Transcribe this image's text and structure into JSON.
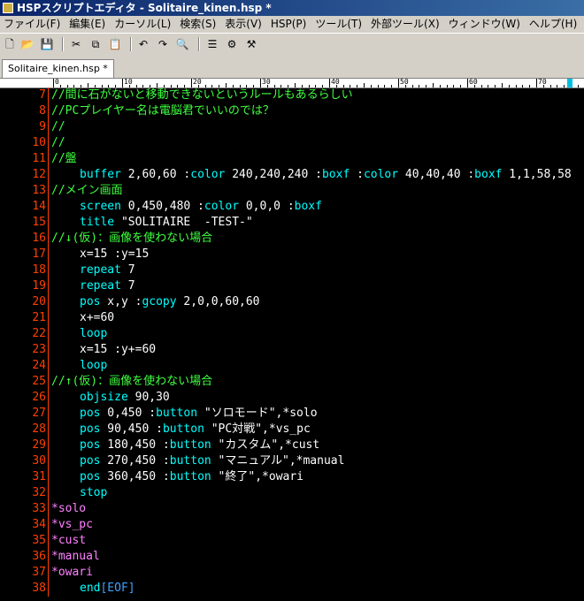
{
  "window": {
    "title": "HSPスクリプトエディタ - Solitaire_kinen.hsp *"
  },
  "menu": [
    "ファイル(F)",
    "編集(E)",
    "カーソル(L)",
    "検索(S)",
    "表示(V)",
    "HSP(P)",
    "ツール(T)",
    "外部ツール(X)",
    "ウィンドウ(W)",
    "ヘルプ(H)"
  ],
  "toolbar": {
    "buttons": [
      {
        "name": "new-file-icon",
        "glyph": "🗋"
      },
      {
        "name": "open-folder-icon",
        "glyph": "📂"
      },
      {
        "name": "save-icon",
        "glyph": "💾"
      },
      {
        "name": "cut-icon",
        "glyph": "✂"
      },
      {
        "name": "copy-icon",
        "glyph": "⧉"
      },
      {
        "name": "paste-icon",
        "glyph": "📋"
      },
      {
        "name": "undo-icon",
        "glyph": "↶"
      },
      {
        "name": "redo-icon",
        "glyph": "↷"
      },
      {
        "name": "find-replace-icon",
        "glyph": "🔍"
      },
      {
        "name": "list-icon",
        "glyph": "☰"
      },
      {
        "name": "run-icon",
        "glyph": "⚙"
      },
      {
        "name": "tools-icon",
        "glyph": "⚒"
      }
    ]
  },
  "tabs": [
    {
      "label": "Solitaire_kinen.hsp *"
    }
  ],
  "ruler": {
    "labels": [
      "0",
      "10",
      "20",
      "30",
      "40",
      "50",
      "60",
      "70"
    ]
  },
  "editor": {
    "lines": [
      {
        "n": "7",
        "indent": false,
        "tokens": [
          [
            "c",
            "//間に石がないと移動できないというルールもあるらしい"
          ]
        ]
      },
      {
        "n": "8",
        "indent": false,
        "tokens": [
          [
            "c",
            "//PCプレイヤー名は電脳君でいいのでは？"
          ]
        ]
      },
      {
        "n": "9",
        "indent": false,
        "tokens": [
          [
            "c",
            "//"
          ]
        ]
      },
      {
        "n": "10",
        "indent": false,
        "tokens": [
          [
            "c",
            "//"
          ]
        ]
      },
      {
        "n": "11",
        "indent": false,
        "tokens": [
          [
            "c",
            "//盤"
          ]
        ]
      },
      {
        "n": "12",
        "indent": true,
        "tokens": [
          [
            "k",
            "buffer"
          ],
          [
            "t",
            " 2,60,60 :"
          ],
          [
            "k",
            "color"
          ],
          [
            "t",
            " 240,240,240 :"
          ],
          [
            "k",
            "boxf"
          ],
          [
            "t",
            " :"
          ],
          [
            "k",
            "color"
          ],
          [
            "t",
            " 40,40,40 :"
          ],
          [
            "k",
            "boxf"
          ],
          [
            "t",
            " 1,1,58,58"
          ]
        ]
      },
      {
        "n": "13",
        "indent": false,
        "tokens": [
          [
            "c",
            "//メイン画面"
          ]
        ]
      },
      {
        "n": "14",
        "indent": true,
        "tokens": [
          [
            "k",
            "screen"
          ],
          [
            "t",
            " 0,450,480 :"
          ],
          [
            "k",
            "color"
          ],
          [
            "t",
            " 0,0,0 :"
          ],
          [
            "k",
            "boxf"
          ]
        ]
      },
      {
        "n": "15",
        "indent": true,
        "tokens": [
          [
            "k",
            "title"
          ],
          [
            "t",
            " \"SOLITAIRE  -TEST-\""
          ]
        ]
      },
      {
        "n": "16",
        "indent": false,
        "tokens": [
          [
            "c",
            "//↓(仮)：画像を使わない場合"
          ]
        ]
      },
      {
        "n": "17",
        "indent": true,
        "tokens": [
          [
            "t",
            "x=15 :y=15"
          ]
        ]
      },
      {
        "n": "18",
        "indent": true,
        "tokens": [
          [
            "k",
            "repeat"
          ],
          [
            "t",
            " 7"
          ]
        ]
      },
      {
        "n": "19",
        "indent": true,
        "tokens": [
          [
            "k",
            "repeat"
          ],
          [
            "t",
            " 7"
          ]
        ]
      },
      {
        "n": "20",
        "indent": true,
        "tokens": [
          [
            "k",
            "pos"
          ],
          [
            "t",
            " x,y :"
          ],
          [
            "k",
            "gcopy"
          ],
          [
            "t",
            " 2,0,0,60,60"
          ]
        ]
      },
      {
        "n": "21",
        "indent": true,
        "tokens": [
          [
            "t",
            "x+=60"
          ]
        ]
      },
      {
        "n": "22",
        "indent": true,
        "tokens": [
          [
            "k",
            "loop"
          ]
        ]
      },
      {
        "n": "23",
        "indent": true,
        "tokens": [
          [
            "t",
            "x=15 :y+=60"
          ]
        ]
      },
      {
        "n": "24",
        "indent": true,
        "tokens": [
          [
            "k",
            "loop"
          ]
        ]
      },
      {
        "n": "25",
        "indent": false,
        "tokens": [
          [
            "c",
            "//↑(仮)：画像を使わない場合"
          ]
        ]
      },
      {
        "n": "26",
        "indent": true,
        "tokens": [
          [
            "k",
            "objsize"
          ],
          [
            "t",
            " 90,30"
          ]
        ]
      },
      {
        "n": "27",
        "indent": true,
        "tokens": [
          [
            "k",
            "pos"
          ],
          [
            "t",
            " 0,450 :"
          ],
          [
            "k",
            "button"
          ],
          [
            "t",
            " \"ソロモード\",*solo"
          ]
        ]
      },
      {
        "n": "28",
        "indent": true,
        "tokens": [
          [
            "k",
            "pos"
          ],
          [
            "t",
            " 90,450 :"
          ],
          [
            "k",
            "button"
          ],
          [
            "t",
            " \"PC対戦\",*vs_pc"
          ]
        ]
      },
      {
        "n": "29",
        "indent": true,
        "tokens": [
          [
            "k",
            "pos"
          ],
          [
            "t",
            " 180,450 :"
          ],
          [
            "k",
            "button"
          ],
          [
            "t",
            " \"カスタム\",*cust"
          ]
        ]
      },
      {
        "n": "30",
        "indent": true,
        "tokens": [
          [
            "k",
            "pos"
          ],
          [
            "t",
            " 270,450 :"
          ],
          [
            "k",
            "button"
          ],
          [
            "t",
            " \"マニュアル\",*manual"
          ]
        ]
      },
      {
        "n": "31",
        "indent": true,
        "tokens": [
          [
            "k",
            "pos"
          ],
          [
            "t",
            " 360,450 :"
          ],
          [
            "k",
            "button"
          ],
          [
            "t",
            " \"終了\",*owari"
          ]
        ]
      },
      {
        "n": "32",
        "indent": true,
        "tokens": [
          [
            "k",
            "stop"
          ]
        ]
      },
      {
        "n": "33",
        "indent": false,
        "tokens": [
          [
            "l",
            "*solo"
          ]
        ]
      },
      {
        "n": "34",
        "indent": false,
        "tokens": [
          [
            "l",
            "*vs_pc"
          ]
        ]
      },
      {
        "n": "35",
        "indent": false,
        "tokens": [
          [
            "l",
            "*cust"
          ]
        ]
      },
      {
        "n": "36",
        "indent": false,
        "tokens": [
          [
            "l",
            "*manual"
          ]
        ]
      },
      {
        "n": "37",
        "indent": false,
        "tokens": [
          [
            "l",
            "*owari"
          ]
        ]
      },
      {
        "n": "38",
        "indent": true,
        "tokens": [
          [
            "k",
            "end"
          ],
          [
            "e",
            "[EOF]"
          ]
        ]
      }
    ]
  },
  "colors": {
    "comment": "#40ff40",
    "keyword": "#00ffff",
    "label": "#ff80ff",
    "text": "#ffffff",
    "line_number": "#ff4000",
    "eof": "#40a0ff",
    "background": "#000000"
  }
}
